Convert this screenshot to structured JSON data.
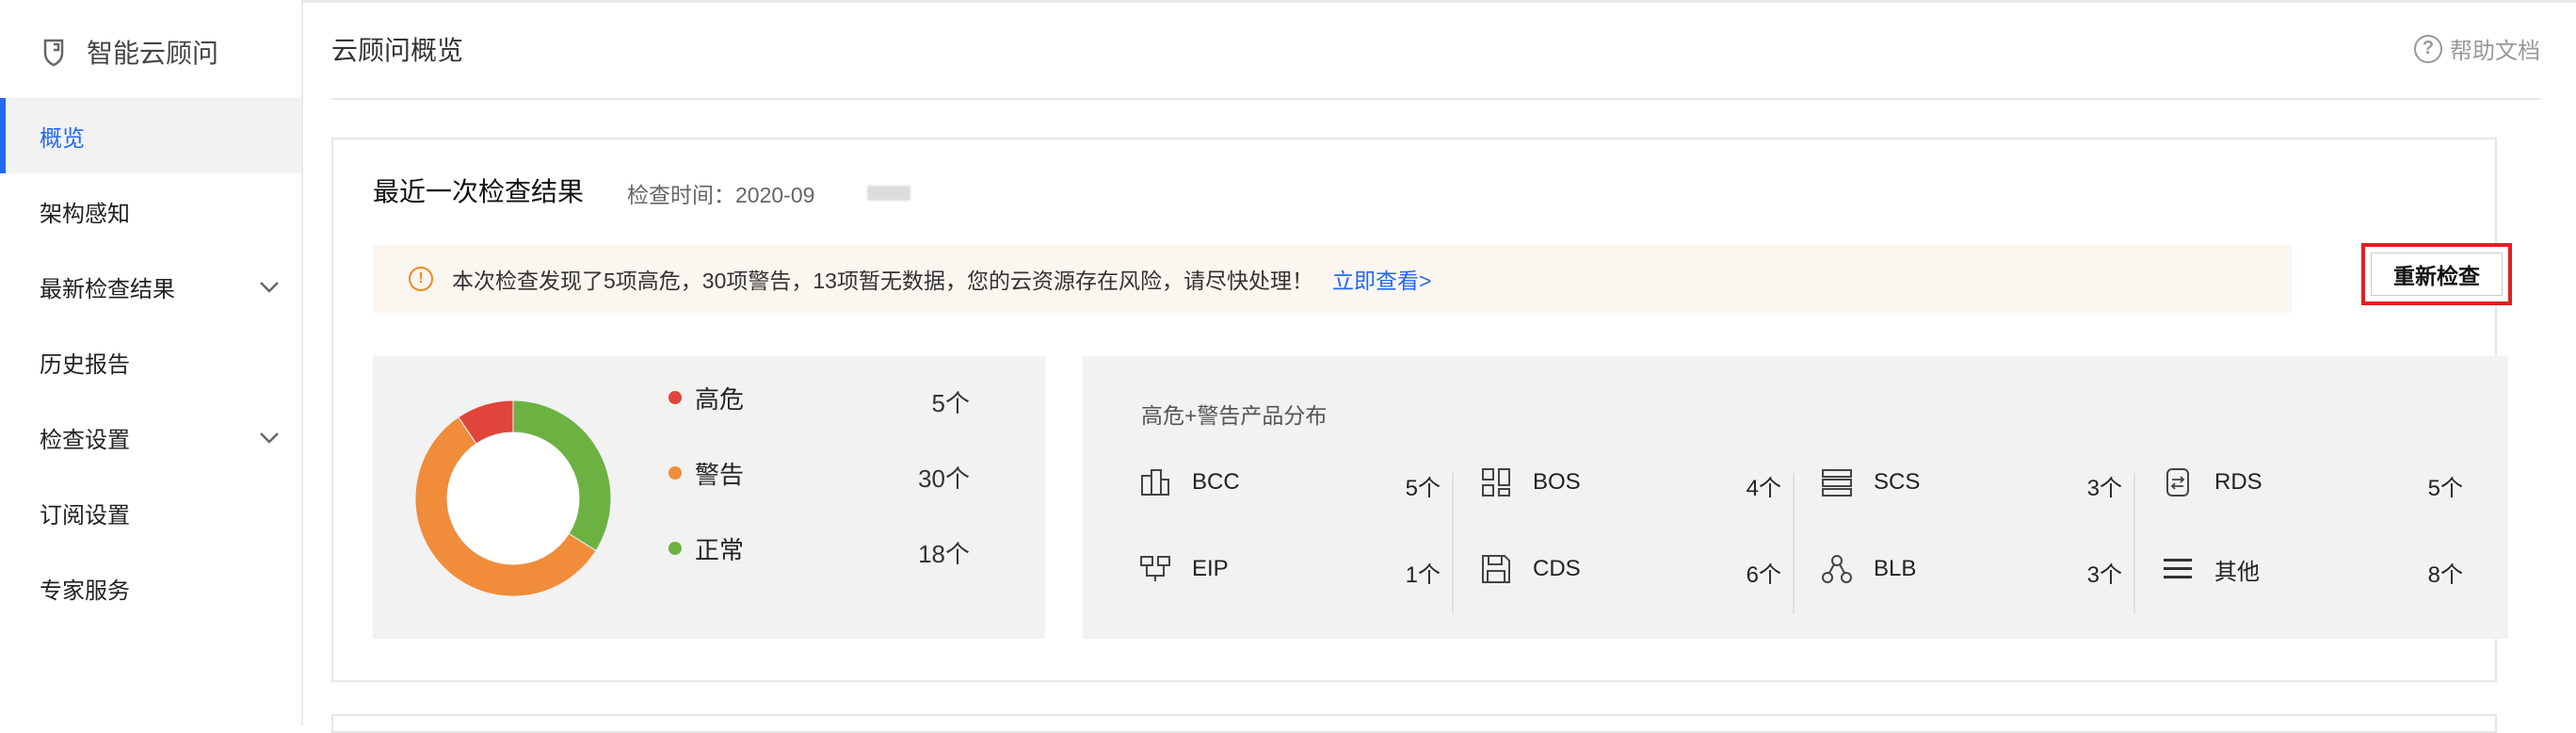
{
  "sidebar": {
    "brand": "智能云顾问",
    "items": [
      {
        "label": "概览"
      },
      {
        "label": "架构感知"
      },
      {
        "label": "最新检查结果"
      },
      {
        "label": "历史报告"
      },
      {
        "label": "检查设置"
      },
      {
        "label": "订阅设置"
      },
      {
        "label": "专家服务"
      }
    ]
  },
  "header": {
    "title": "云顾问概览",
    "help_label": "帮助文档"
  },
  "card": {
    "title": "最近一次检查结果",
    "check_time": "检查时间：2020-09",
    "alert_text": "本次检查发现了5项高危，30项警告，13项暂无数据，您的云资源存在风险，请尽快处理！",
    "alert_link": "立即查看>",
    "recheck_label": "重新检查"
  },
  "summary": {
    "legend": [
      {
        "label": "高危",
        "count": "5个",
        "color": "#e0443a"
      },
      {
        "label": "警告",
        "count": "30个",
        "color": "#f08c3a"
      },
      {
        "label": "正常",
        "count": "18个",
        "color": "#6cb243"
      }
    ]
  },
  "distribution": {
    "title": "高危+警告产品分布",
    "products": [
      {
        "name": "BCC",
        "count": "5个",
        "icon": "bcc-icon"
      },
      {
        "name": "BOS",
        "count": "4个",
        "icon": "bos-icon"
      },
      {
        "name": "SCS",
        "count": "3个",
        "icon": "scs-icon"
      },
      {
        "name": "RDS",
        "count": "5个",
        "icon": "rds-icon"
      },
      {
        "name": "EIP",
        "count": "1个",
        "icon": "eip-icon"
      },
      {
        "name": "CDS",
        "count": "6个",
        "icon": "cds-icon"
      },
      {
        "name": "BLB",
        "count": "3个",
        "icon": "blb-icon"
      },
      {
        "name": "其他",
        "count": "8个",
        "icon": "list-icon"
      }
    ]
  },
  "chart_data": {
    "type": "pie",
    "categories": [
      "高危",
      "警告",
      "正常"
    ],
    "values": [
      5,
      30,
      18
    ],
    "colors": [
      "#e0443a",
      "#f08c3a",
      "#6cb243"
    ]
  }
}
